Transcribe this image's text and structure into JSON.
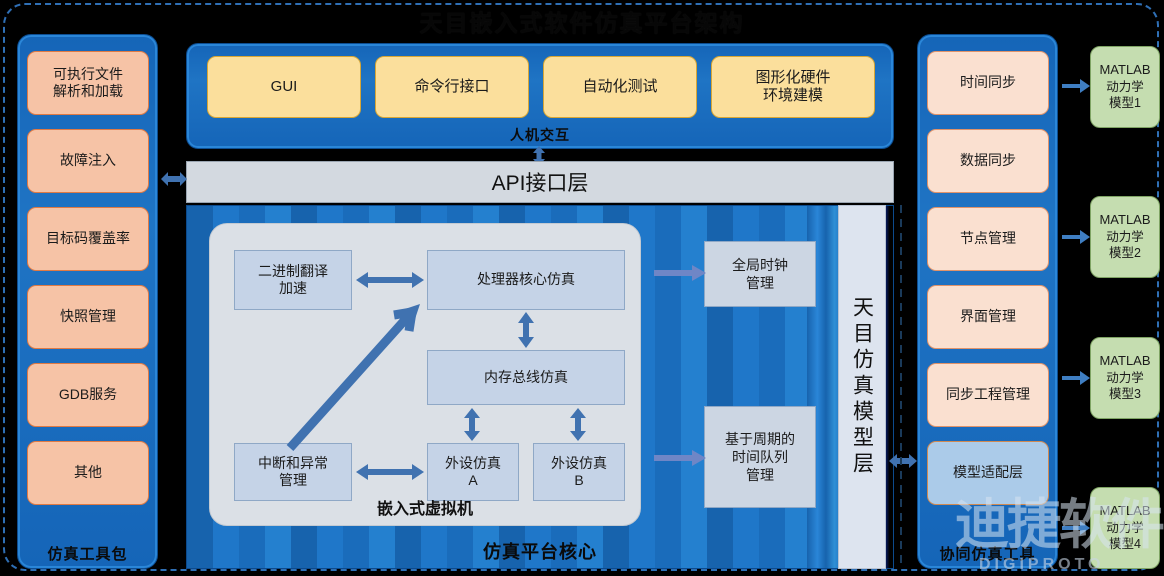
{
  "title": "天目嵌入式软件仿真平台架构",
  "watermark": {
    "cn": "迪捷软件",
    "en": "DIGIPROTO"
  },
  "left_panel": {
    "caption": "仿真工具包",
    "items": [
      {
        "label": "可执行文件\n解析和加载"
      },
      {
        "label": "故障注入"
      },
      {
        "label": "目标码覆盖率"
      },
      {
        "label": "快照管理"
      },
      {
        "label": "GDB服务"
      },
      {
        "label": "其他"
      }
    ]
  },
  "top_band": {
    "caption": "人机交互",
    "items": [
      {
        "label": "GUI"
      },
      {
        "label": "命令行接口"
      },
      {
        "label": "自动化测试"
      },
      {
        "label": "图形化硬件\n环境建模"
      }
    ]
  },
  "api_layer": {
    "label": "API接口层"
  },
  "core": {
    "caption": "仿真平台核心",
    "vm": {
      "caption": "嵌入式虚拟机",
      "nodes": [
        {
          "label": "二进制翻译\n加速"
        },
        {
          "label": "处理器核心仿真"
        },
        {
          "label": "内存总线仿真"
        },
        {
          "label": "中断和异常\n管理"
        },
        {
          "label": "外设仿真\nA"
        },
        {
          "label": "外设仿真\nB"
        }
      ]
    },
    "clock_nodes": [
      {
        "label": "全局时钟\n管理"
      },
      {
        "label": "基于周期的\n时间队列\n管理"
      }
    ]
  },
  "tianmu_column": {
    "label": "天目仿真模型层"
  },
  "right_panel": {
    "caption": "协同仿真工具",
    "items": [
      {
        "label": "时间同步"
      },
      {
        "label": "数据同步"
      },
      {
        "label": "节点管理"
      },
      {
        "label": "界面管理"
      },
      {
        "label": "同步工程管理"
      },
      {
        "label": "模型适配层"
      }
    ]
  },
  "matlab_models": [
    {
      "title": "MATLAB",
      "sub1": "动力学",
      "sub2": "模型1"
    },
    {
      "title": "MATLAB",
      "sub1": "动力学",
      "sub2": "模型2"
    },
    {
      "title": "MATLAB",
      "sub1": "动力学",
      "sub2": "模型3"
    },
    {
      "title": "MATLAB",
      "sub1": "动力学",
      "sub2": "模型4"
    }
  ],
  "colors": {
    "panel_blue": "#1f74c4",
    "tool_peach": "#f6c3a6",
    "sync_peach": "#fae0d0",
    "adapter_blue": "#abcbe9",
    "yellow": "#fbdf9c",
    "vm_node": "#c5d3e7",
    "matlab_green": "#c5ddb0",
    "arrow_blue": "#4072b0"
  }
}
